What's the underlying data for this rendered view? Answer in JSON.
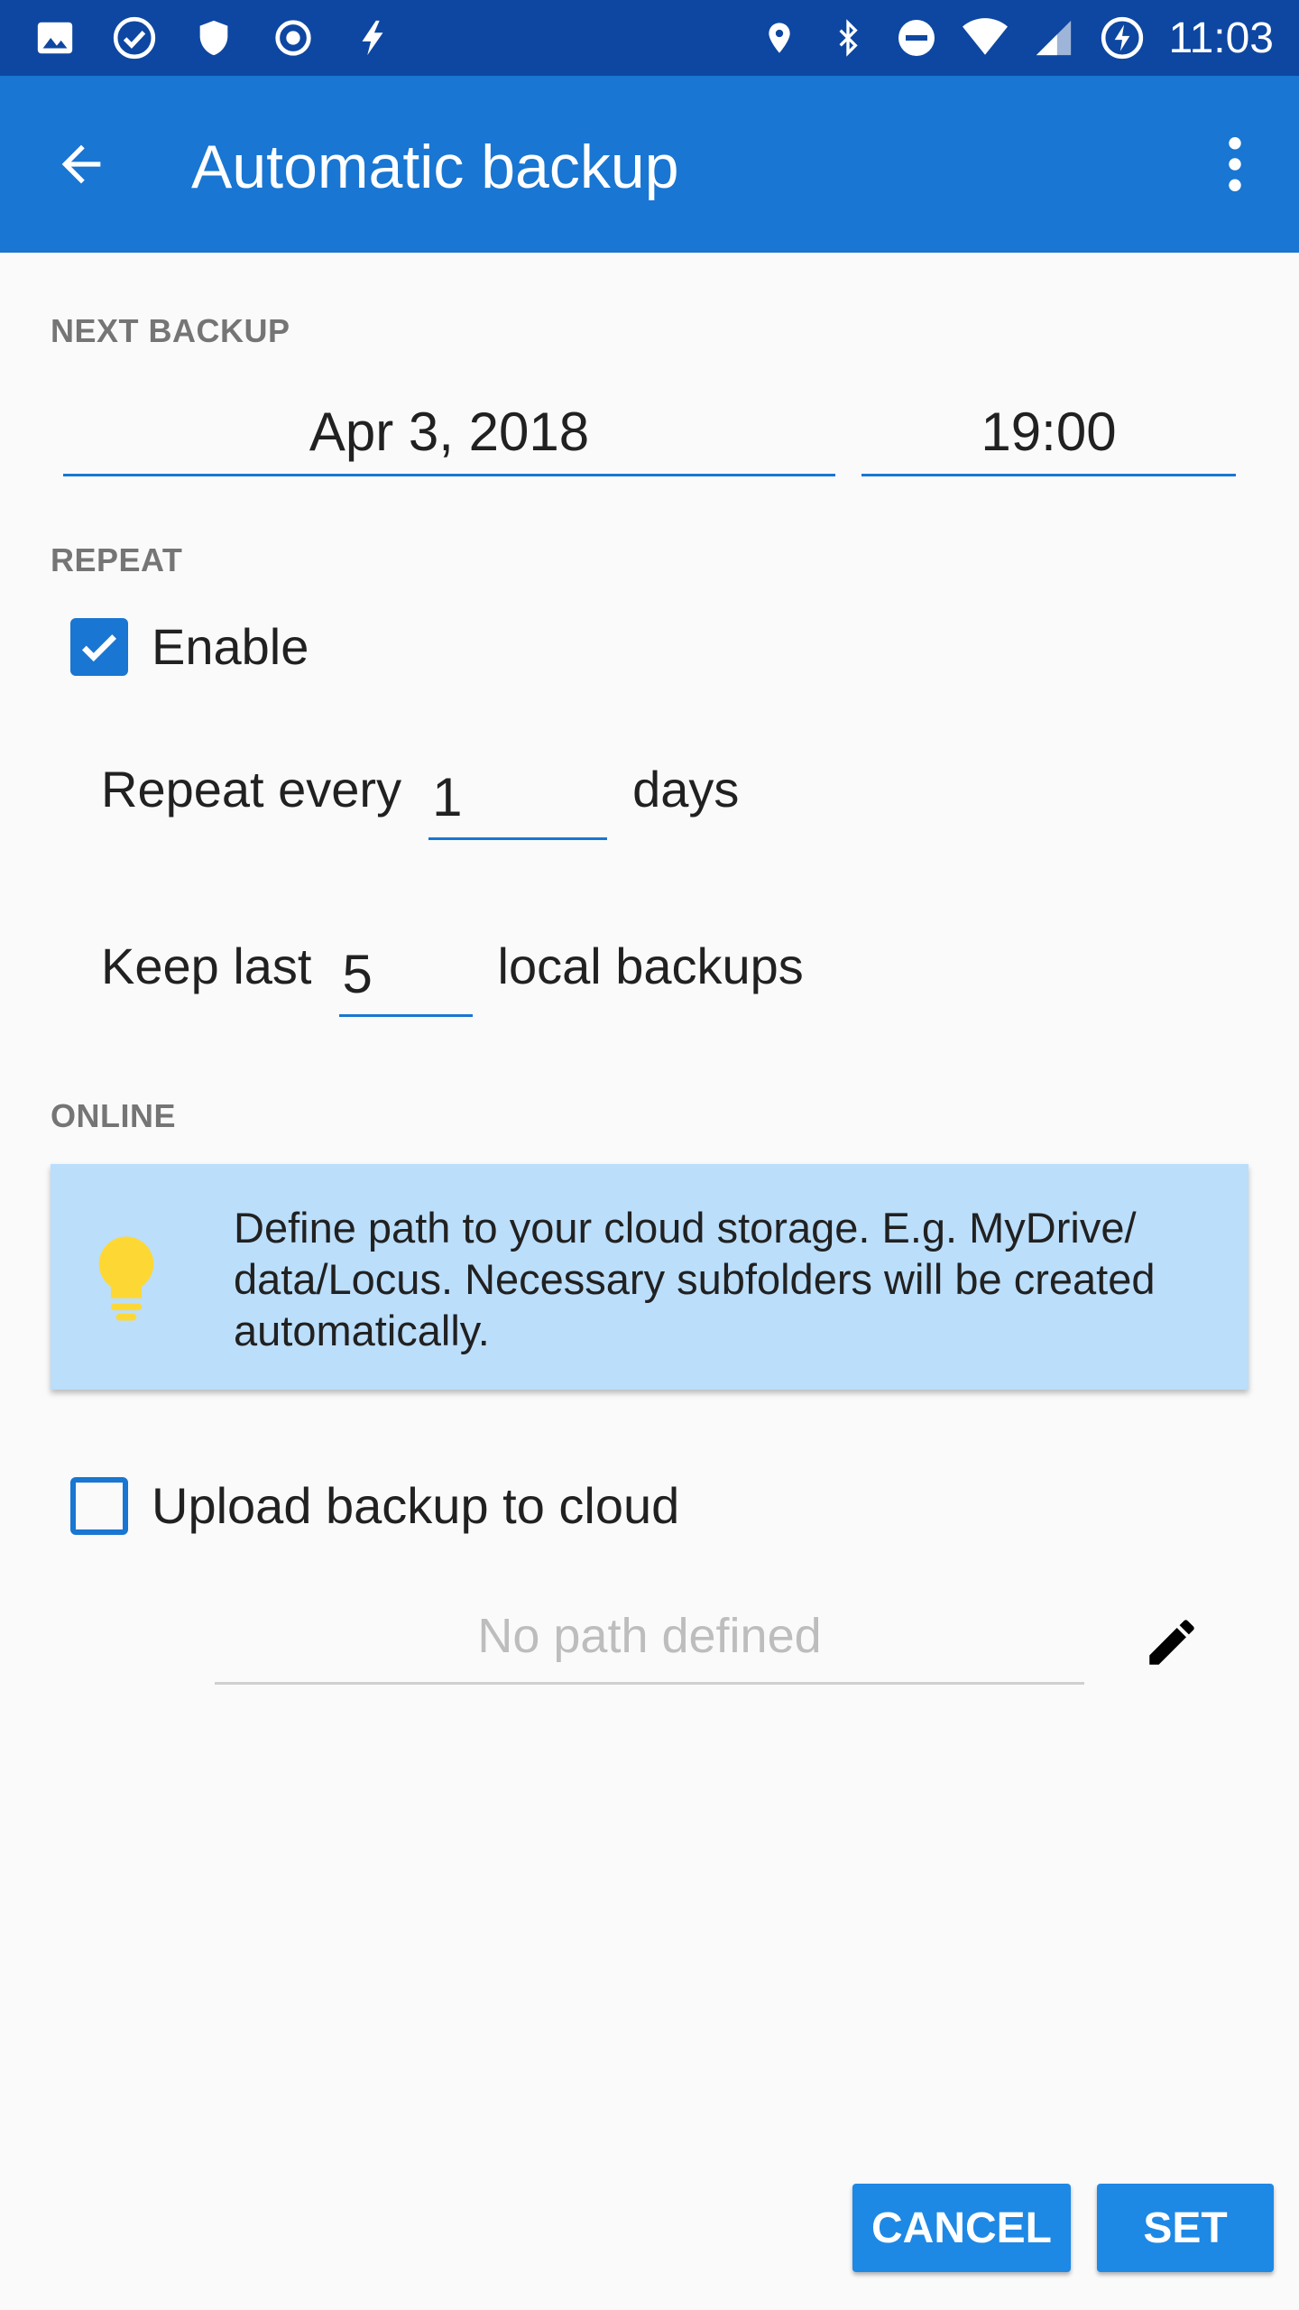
{
  "status_bar": {
    "time": "11:03",
    "left_icons": [
      "image-icon",
      "check-circle-icon",
      "shield-icon",
      "target-icon",
      "lightning-icon"
    ],
    "right_icons": [
      "location-icon",
      "bluetooth-icon",
      "do-not-disturb-icon",
      "wifi-icon",
      "signal-icon",
      "battery-charging-icon"
    ]
  },
  "app_bar": {
    "title": "Automatic backup",
    "back_icon": "arrow-back-icon",
    "menu_icon": "more-vert-icon"
  },
  "next_backup": {
    "header": "NEXT BACKUP",
    "date": "Apr 3, 2018",
    "time": "19:00"
  },
  "repeat": {
    "header": "REPEAT",
    "enable_label": "Enable",
    "enable_checked": true,
    "repeat_every_label": "Repeat every",
    "repeat_every_value": "1",
    "repeat_every_unit": "days",
    "keep_last_label": "Keep last",
    "keep_last_value": "5",
    "keep_last_unit": "local backups"
  },
  "online": {
    "header": "ONLINE",
    "info_text": "Define path to your cloud storage. E.g. MyDrive/ data/Locus. Necessary subfolders will be created automatically.",
    "upload_label": "Upload backup to cloud",
    "upload_checked": false,
    "path_placeholder": "No path defined"
  },
  "buttons": {
    "cancel": "CANCEL",
    "set": "SET"
  },
  "colors": {
    "status_bar": "#0d47a1",
    "app_bar": "#1976d2",
    "accent": "#1976d2",
    "info_bg": "#bbdefb",
    "bulb": "#fdd835",
    "button": "#1e88e5"
  }
}
